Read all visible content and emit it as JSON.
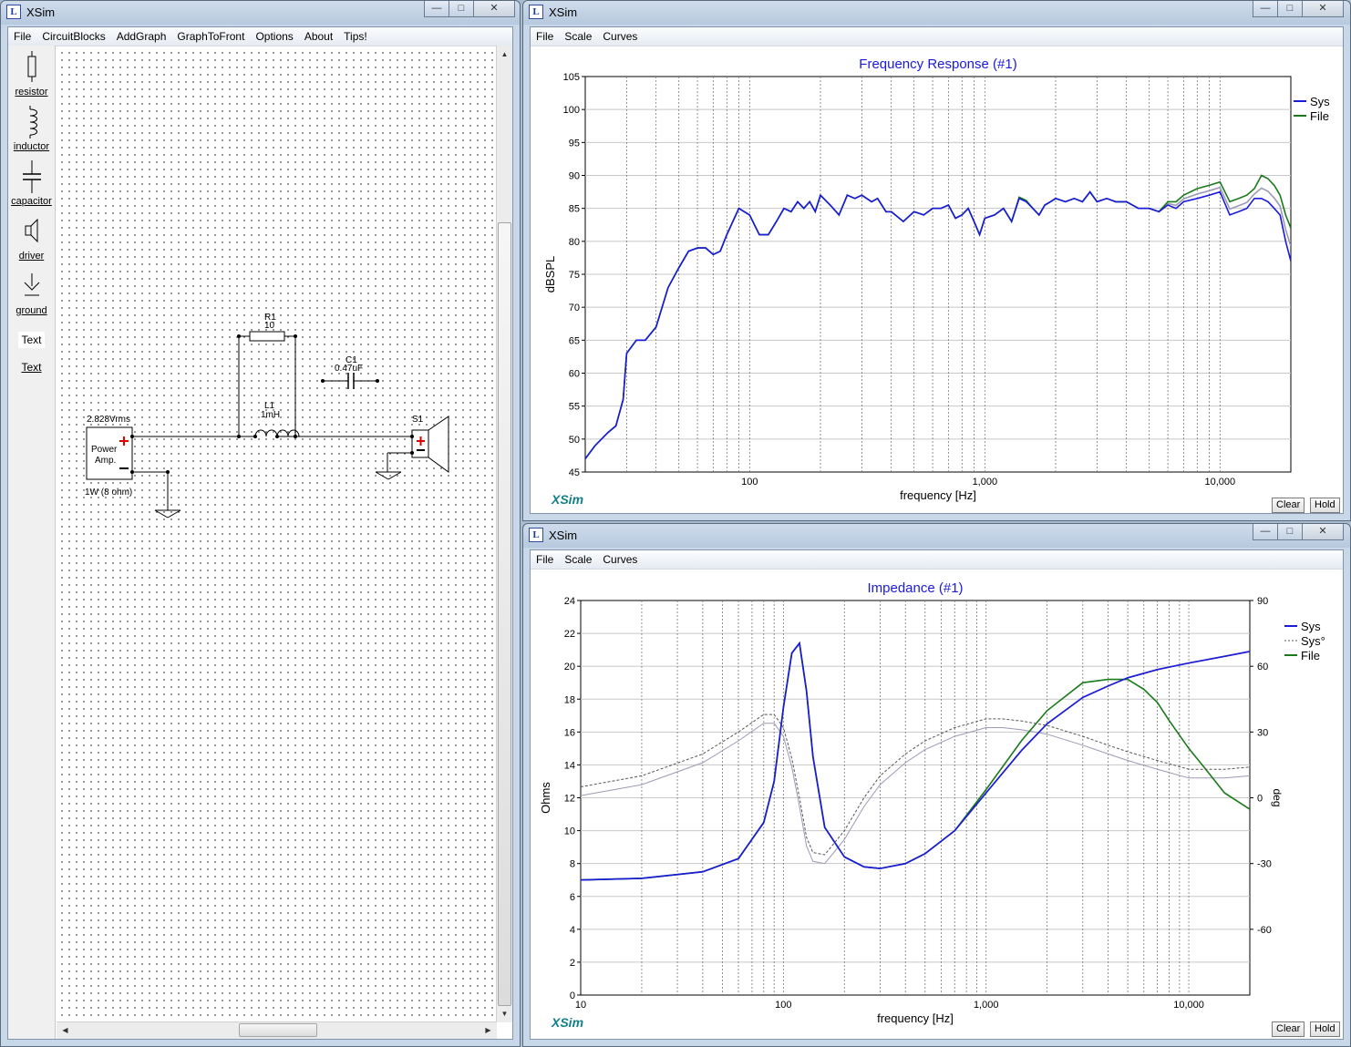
{
  "colors": {
    "sys": "#1a1adc",
    "file": "#1a7a1a",
    "file_gray": "#9a9ab4",
    "title_blue": "#1a1adc",
    "logo_teal": "#11808a",
    "pos_red": "#e00000"
  },
  "schematic_window": {
    "title": "XSim",
    "menu": [
      "File",
      "CircuitBlocks",
      "AddGraph",
      "GraphToFront",
      "Options",
      "About",
      "Tips!"
    ],
    "tools": [
      {
        "label": "resistor",
        "icon": "resistor-icon"
      },
      {
        "label": "inductor",
        "icon": "inductor-icon"
      },
      {
        "label": "capacitor",
        "icon": "capacitor-icon"
      },
      {
        "label": "driver",
        "icon": "driver-icon"
      },
      {
        "label": "ground",
        "icon": "ground-icon"
      },
      {
        "label": "Text",
        "icon": "text-icon"
      },
      {
        "label": "Text",
        "icon": "text-link"
      }
    ],
    "circuit": {
      "r1_name": "R1",
      "r1_value": "10",
      "c1_name": "C1",
      "c1_value": "0.47uF",
      "l1_name": "L1",
      "l1_value": "1mH",
      "amp_voltage": "2.828Vrms",
      "amp_label1": "Power",
      "amp_label2": "Amp.",
      "amp_power": "1W (8 ohm)",
      "driver_name": "S1"
    }
  },
  "freq_window": {
    "title": "XSim",
    "menu": [
      "File",
      "Scale",
      "Curves"
    ],
    "logo": "XSim",
    "buttons": {
      "clear": "Clear",
      "hold": "Hold"
    }
  },
  "imp_window": {
    "title": "XSim",
    "menu": [
      "File",
      "Scale",
      "Curves"
    ],
    "logo": "XSim",
    "buttons": {
      "clear": "Clear",
      "hold": "Hold"
    }
  },
  "chart_data": [
    {
      "type": "line",
      "title": "Frequency Response (#1)",
      "xlabel": "frequency [Hz]",
      "ylabel": "dBSPL",
      "x_scale": "log",
      "xlim": [
        20,
        20000
      ],
      "ylim": [
        45,
        105
      ],
      "yticks": [
        45,
        50,
        55,
        60,
        65,
        70,
        75,
        80,
        85,
        90,
        95,
        100,
        105
      ],
      "xtick_labels": [
        {
          "v": 100,
          "t": "100"
        },
        {
          "v": 1000,
          "t": "1,000"
        },
        {
          "v": 10000,
          "t": "10,000"
        }
      ],
      "grid": true,
      "legend": "top-right",
      "series": [
        {
          "name": "Sys",
          "color": "#1a1adc",
          "x": [
            20,
            22,
            25,
            27,
            29,
            30,
            33,
            36,
            40,
            45,
            50,
            55,
            60,
            65,
            70,
            75,
            80,
            90,
            100,
            110,
            120,
            130,
            140,
            150,
            160,
            170,
            180,
            190,
            200,
            220,
            240,
            260,
            280,
            300,
            330,
            350,
            380,
            400,
            450,
            500,
            550,
            600,
            650,
            700,
            750,
            800,
            850,
            900,
            950,
            1000,
            1100,
            1200,
            1300,
            1400,
            1500,
            1600,
            1700,
            1800,
            1900,
            2000,
            2200,
            2400,
            2600,
            2800,
            3000,
            3300,
            3600,
            4000,
            4500,
            5000,
            5500,
            6000,
            6500,
            7000,
            8000,
            9000,
            10000,
            11000,
            12000,
            13000,
            14000,
            15000,
            16000,
            17000,
            18000,
            19000,
            20000
          ],
          "y": [
            47,
            49,
            51,
            52,
            56,
            63,
            65,
            65,
            67,
            73,
            76,
            78.5,
            79,
            79,
            78,
            78.5,
            81,
            85,
            84,
            81,
            81,
            83,
            85,
            84.5,
            86,
            85,
            86,
            84.5,
            87,
            85.5,
            84,
            87,
            86.5,
            87,
            86,
            86.5,
            84.5,
            84.5,
            83,
            84.5,
            84,
            85,
            85,
            85.5,
            83.5,
            84,
            85,
            83,
            81,
            83.5,
            84,
            85,
            83,
            86.5,
            86,
            85,
            84,
            85.5,
            86,
            86.5,
            86,
            86.5,
            86,
            87.5,
            86,
            86.5,
            86,
            86,
            85,
            85,
            84.5,
            85.5,
            85,
            86,
            86.5,
            87,
            87.5,
            84,
            84.5,
            85,
            86.5,
            86.5,
            86,
            85,
            84,
            80,
            77
          ]
        },
        {
          "name": "File",
          "color": "#1a7a1a",
          "x": [
            20,
            22,
            25,
            27,
            29,
            30,
            33,
            36,
            40,
            45,
            50,
            55,
            60,
            65,
            70,
            75,
            80,
            90,
            100,
            110,
            120,
            130,
            140,
            150,
            160,
            170,
            180,
            190,
            200,
            220,
            240,
            260,
            280,
            300,
            330,
            350,
            380,
            400,
            450,
            500,
            550,
            600,
            650,
            700,
            750,
            800,
            850,
            900,
            950,
            1000,
            1100,
            1200,
            1300,
            1400,
            1500,
            1600,
            1700,
            1800,
            1900,
            2000,
            2200,
            2400,
            2600,
            2800,
            3000,
            3300,
            3600,
            4000,
            4500,
            5000,
            5500,
            6000,
            6500,
            7000,
            8000,
            9000,
            10000,
            11000,
            12000,
            13000,
            14000,
            15000,
            16000,
            17000,
            18000,
            19000,
            20000
          ],
          "y": [
            47,
            49,
            51,
            52,
            56,
            63,
            65,
            65,
            67,
            73,
            76,
            78.5,
            79,
            79,
            78,
            78.5,
            81,
            85,
            84,
            81,
            81,
            83,
            85,
            84.5,
            86,
            85,
            86,
            84.5,
            87,
            85.5,
            84,
            87,
            86.5,
            87,
            86,
            86.5,
            84.5,
            84.5,
            83,
            84.5,
            84,
            85,
            85,
            85.5,
            83.5,
            84,
            85,
            83,
            81,
            83.5,
            84,
            85,
            83,
            86.7,
            86.2,
            85,
            84,
            85.5,
            86,
            86.5,
            86,
            86.5,
            86,
            87.5,
            86,
            86.5,
            86,
            86,
            85,
            85,
            84.5,
            86,
            86,
            87,
            88,
            88.5,
            89,
            86,
            86.5,
            87,
            88,
            90,
            89.5,
            88.5,
            87,
            84,
            82
          ]
        }
      ]
    },
    {
      "type": "line",
      "title": "Impedance (#1)",
      "xlabel": "frequency [Hz]",
      "ylabel": "Ohms",
      "y2label": "deg",
      "x_scale": "log",
      "xlim": [
        10,
        20000
      ],
      "ylim": [
        0,
        24
      ],
      "y2lim": [
        -90,
        90
      ],
      "yticks": [
        0,
        2,
        4,
        6,
        8,
        10,
        12,
        14,
        16,
        18,
        20,
        22,
        24
      ],
      "y2ticks": [
        -60,
        -30,
        0,
        30,
        60,
        90
      ],
      "xtick_labels": [
        {
          "v": 10,
          "t": "10"
        },
        {
          "v": 100,
          "t": "100"
        },
        {
          "v": 1000,
          "t": "1,000"
        },
        {
          "v": 10000,
          "t": "10,000"
        }
      ],
      "grid": true,
      "legend": "top-right",
      "legend_entries": [
        {
          "name": "Sys",
          "style": "solid",
          "color": "#1a1adc"
        },
        {
          "name": "Sys°",
          "style": "dashed",
          "color": "#555555"
        },
        {
          "name": "File",
          "style": "solid",
          "color": "#1a7a1a"
        }
      ],
      "series": [
        {
          "name": "Sys",
          "axis": "left",
          "color": "#1a1adc",
          "x": [
            10,
            20,
            40,
            60,
            80,
            90,
            100,
            110,
            120,
            130,
            140,
            160,
            200,
            250,
            300,
            400,
            500,
            700,
            1000,
            1500,
            2000,
            3000,
            4000,
            5000,
            7000,
            10000,
            15000,
            20000
          ],
          "y": [
            7,
            7.1,
            7.5,
            8.3,
            10.5,
            13,
            17.5,
            20.8,
            21.4,
            18.5,
            14.5,
            10.2,
            8.4,
            7.8,
            7.7,
            8,
            8.6,
            10,
            12.3,
            14.9,
            16.5,
            18.1,
            18.8,
            19.3,
            19.8,
            20.2,
            20.6,
            20.9
          ]
        },
        {
          "name": "Sys°",
          "axis": "right",
          "color": "#555555",
          "x": [
            10,
            20,
            40,
            60,
            80,
            90,
            100,
            110,
            120,
            130,
            140,
            160,
            200,
            250,
            300,
            400,
            500,
            700,
            1000,
            1200,
            1500,
            2000,
            3000,
            4000,
            5000,
            7000,
            10000,
            15000,
            20000
          ],
          "y": [
            5,
            10,
            20,
            30,
            38,
            38,
            32,
            18,
            0,
            -18,
            -25,
            -26,
            -15,
            0,
            10,
            20,
            26,
            32,
            36,
            36,
            35,
            33,
            28,
            24,
            21,
            17,
            13,
            13,
            14
          ]
        },
        {
          "name": "File",
          "axis": "left",
          "color": "#1a7a1a",
          "x": [
            10,
            20,
            40,
            60,
            80,
            90,
            100,
            110,
            120,
            130,
            140,
            160,
            200,
            250,
            300,
            400,
            500,
            700,
            1000,
            1500,
            2000,
            3000,
            4000,
            5000,
            6000,
            7000,
            8000,
            10000,
            12000,
            15000,
            20000
          ],
          "y": [
            7,
            7.1,
            7.5,
            8.3,
            10.5,
            13,
            17.5,
            20.8,
            21.4,
            18.5,
            14.5,
            10.2,
            8.4,
            7.8,
            7.7,
            8,
            8.6,
            10,
            12.5,
            15.5,
            17.3,
            19,
            19.2,
            19.2,
            18.6,
            17.8,
            16.7,
            15,
            13.8,
            12.3,
            11.3
          ]
        }
      ]
    }
  ]
}
